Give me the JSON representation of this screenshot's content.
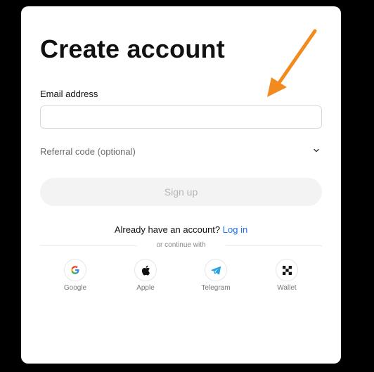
{
  "form": {
    "title": "Create account",
    "email_label": "Email address",
    "email_value": "",
    "email_placeholder": "",
    "referral_label": "Referral code (optional)",
    "signup_label": "Sign up",
    "login_prompt": "Already have an account?",
    "login_link": "Log in",
    "continue_text": "or continue with"
  },
  "social": [
    {
      "label": "Google",
      "icon": "google-icon"
    },
    {
      "label": "Apple",
      "icon": "apple-icon"
    },
    {
      "label": "Telegram",
      "icon": "telegram-icon"
    },
    {
      "label": "Wallet",
      "icon": "wallet-icon"
    }
  ],
  "colors": {
    "page_background": "#000000",
    "card_background": "#ffffff",
    "link": "#1f6fe5",
    "button_disabled_bg": "#f3f3f3",
    "annotation_arrow": "#f28a1e"
  }
}
